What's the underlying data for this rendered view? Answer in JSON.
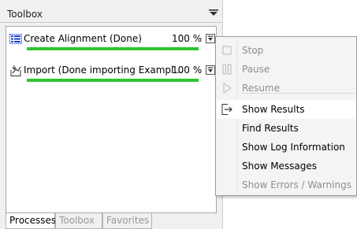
{
  "panel": {
    "title": "Toolbox"
  },
  "processes": [
    {
      "name": "Create Alignment (Done)",
      "percent_label": "100 %",
      "progress": 1.0
    },
    {
      "name": "Import (Done importing Exampl...",
      "percent_label": "100 %",
      "progress": 1.0
    }
  ],
  "tabs": [
    {
      "label": "Processes",
      "active": true
    },
    {
      "label": "Toolbox",
      "active": false
    },
    {
      "label": "Favorites",
      "active": false
    }
  ],
  "context_menu": {
    "items": [
      {
        "label": "Stop",
        "enabled": false,
        "icon": "stop-icon"
      },
      {
        "label": "Pause",
        "enabled": false,
        "icon": "pause-icon"
      },
      {
        "label": "Resume",
        "enabled": false,
        "icon": "play-icon"
      },
      {
        "label": "Show Results",
        "enabled": true,
        "icon": "show-results-icon"
      },
      {
        "label": "Find Results",
        "enabled": true
      },
      {
        "label": "Show Log Information",
        "enabled": true
      },
      {
        "label": "Show Messages",
        "enabled": true
      },
      {
        "label": "Show Errors / Warnings",
        "enabled": false
      }
    ]
  },
  "colors": {
    "progress": "#2fc42f",
    "alignment_icon": "#1a3fd0"
  }
}
